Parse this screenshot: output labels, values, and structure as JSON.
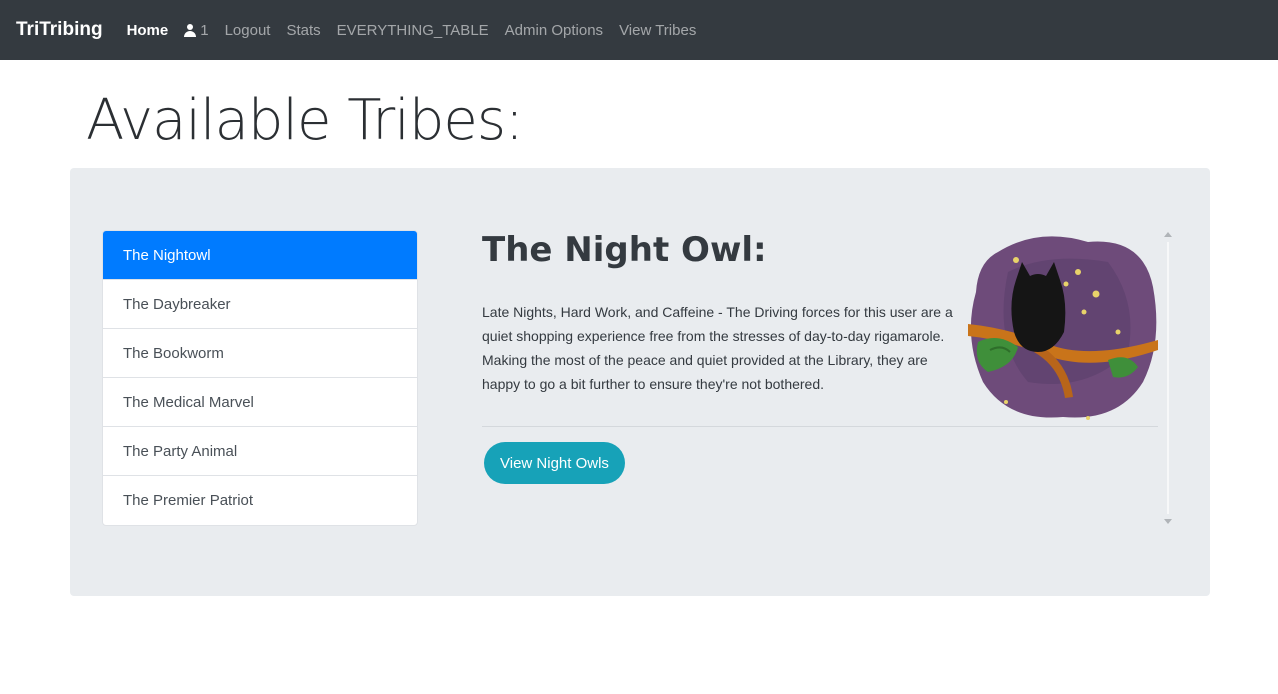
{
  "navbar": {
    "brand": "TriTribing",
    "links": [
      {
        "label": "Home",
        "active": true
      },
      {
        "label": "1",
        "icon": "user-icon"
      },
      {
        "label": "Logout"
      },
      {
        "label": "Stats"
      },
      {
        "label": "EVERYTHING_TABLE"
      },
      {
        "label": "Admin Options"
      },
      {
        "label": "View Tribes"
      }
    ]
  },
  "page": {
    "title": "Available Tribes:"
  },
  "tribes": {
    "items": [
      {
        "label": "The Nightowl",
        "active": true
      },
      {
        "label": "The Daybreaker"
      },
      {
        "label": "The Bookworm"
      },
      {
        "label": "The Medical Marvel"
      },
      {
        "label": "The Party Animal"
      },
      {
        "label": "The Premier Patriot"
      }
    ]
  },
  "selected_tribe": {
    "heading": "The Night Owl:",
    "description": "Late Nights, Hard Work, and Caffeine - The Driving forces for this user are a quiet shopping experience free from the stresses of day-to-day rigamarole. Making the most of the peace and quiet provided at the Library, they are happy to go a bit further to ensure they're not bothered.",
    "button_label": "View Night Owls",
    "image_icon": "night-owl-illustration"
  },
  "colors": {
    "navbar_bg": "#343a40",
    "active_item": "#007bff",
    "button": "#17a2b8",
    "panel_bg": "#e9ecef",
    "owl_bg": "#6e4b7a"
  }
}
